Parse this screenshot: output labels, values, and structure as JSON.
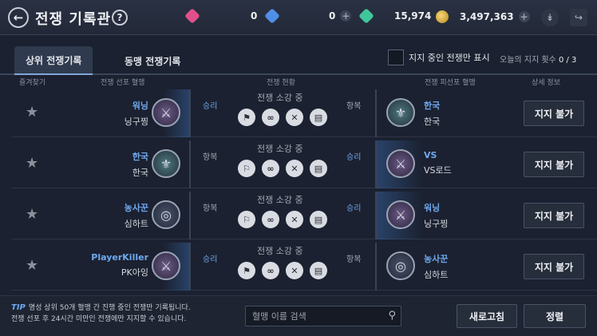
{
  "header": {
    "title": "전쟁 기록관",
    "currencies": [
      {
        "name": "red-gem",
        "value": "0",
        "color": "#e0508a"
      },
      {
        "name": "blue-gem",
        "value": "0",
        "color": "#4f8fe6"
      },
      {
        "name": "green-gem",
        "value": "15,974",
        "color": "#3fc79a"
      },
      {
        "name": "gold",
        "value": "3,497,363",
        "color": "#e0b54a"
      }
    ]
  },
  "tabs": [
    {
      "label": "상위 전쟁기록",
      "active": true
    },
    {
      "label": "동맹 전쟁기록",
      "active": false
    }
  ],
  "filter": {
    "label": "지지 중인 전쟁만 표시",
    "checked": false
  },
  "today_support": {
    "label": "오늘의 지지 횟수",
    "value": "0 / 3"
  },
  "columns": {
    "favorite": "즐겨찾기",
    "attacker": "전쟁 선포 혈맹",
    "war_info": "전쟁 현황",
    "defender": "전쟁 피선포 혈맹",
    "details": "상세 정보"
  },
  "rows": [
    {
      "left_guild": "워닝",
      "left_leader": "닝구찡",
      "left_result": "승리",
      "status": "전쟁 소강 중",
      "right_result": "항복",
      "right_guild": "한국",
      "right_leader": "한국",
      "button": "지지 불가"
    },
    {
      "left_guild": "한국",
      "left_leader": "한국",
      "left_result": "항복",
      "status": "전쟁 소강 중",
      "right_result": "승리",
      "right_guild": "VS",
      "right_leader": "VS로드",
      "button": "지지 불가"
    },
    {
      "left_guild": "농사꾼",
      "left_leader": "심하트",
      "left_result": "항복",
      "status": "전쟁 소강 중",
      "right_result": "승리",
      "right_guild": "워닝",
      "right_leader": "닝구찡",
      "button": "지지 불가"
    },
    {
      "left_guild": "PlayerKiller",
      "left_leader": "PK아잉",
      "left_result": "승리",
      "status": "전쟁 소강 중",
      "right_result": "항복",
      "right_guild": "농사꾼",
      "right_leader": "심하트",
      "button": "지지 불가"
    }
  ],
  "footer": {
    "tip_label": "TIP",
    "tip_line1": "명성 상위 50개 혈맹 간 진행 중인 전쟁만 기록됩니다.",
    "tip_line2": "전쟁 선포 후 24시간 미만인 전쟁에만 지지할 수 있습니다.",
    "search_placeholder": "혈맹 이름 검색",
    "refresh_label": "새로고침",
    "sort_label": "정렬"
  }
}
